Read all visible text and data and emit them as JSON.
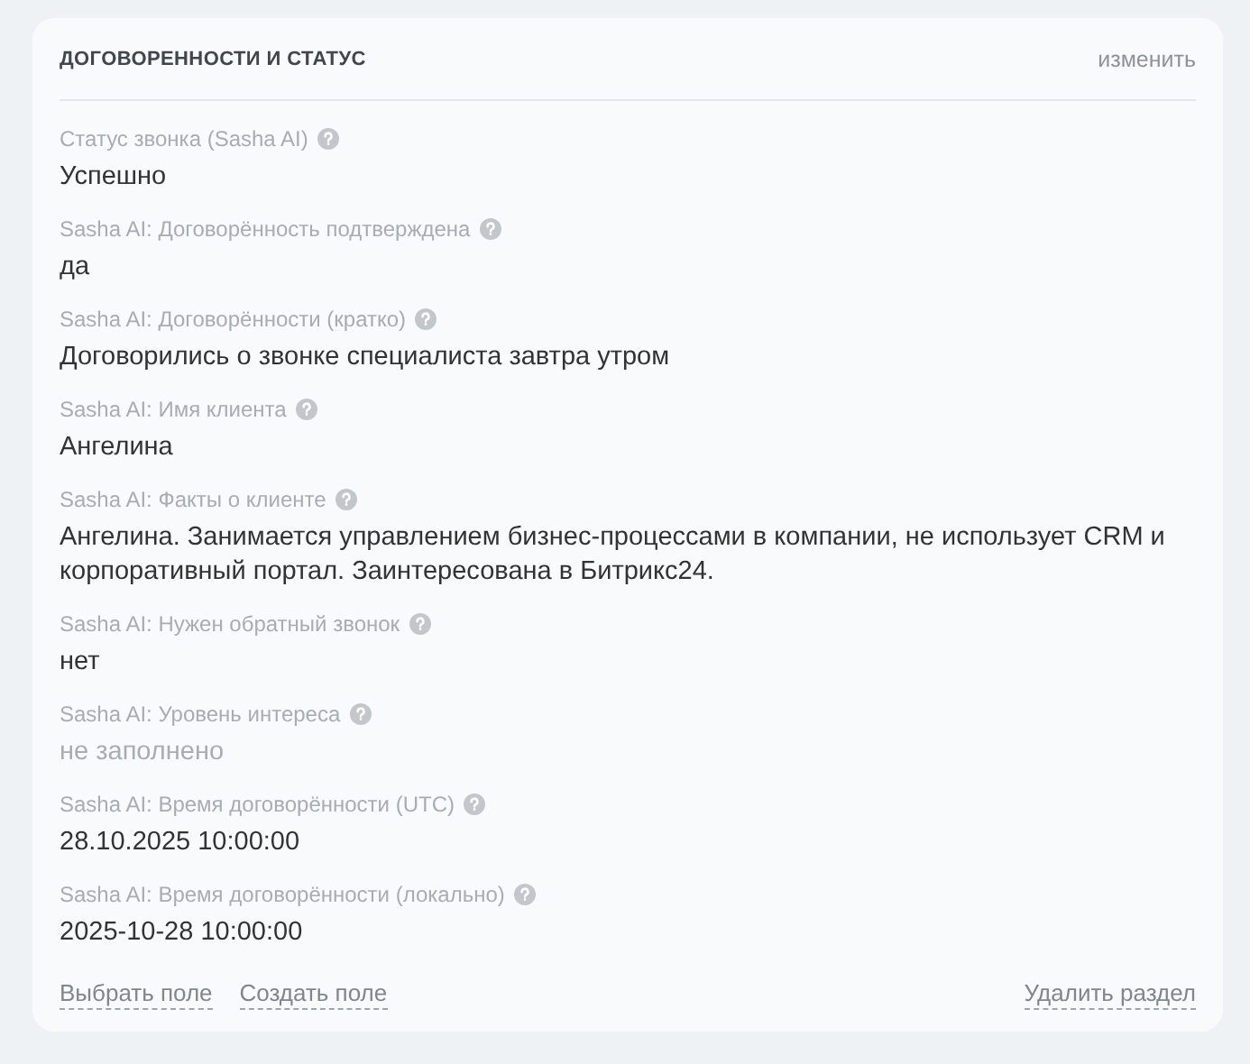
{
  "section": {
    "title": "ДОГОВОРЕННОСТИ И СТАТУС",
    "edit_link": "изменить",
    "fields": [
      {
        "label": "Статус звонка (Sasha AI)",
        "value": "Успешно",
        "empty": false
      },
      {
        "label": "Sasha AI: Договорённость подтверждена",
        "value": "да",
        "empty": false
      },
      {
        "label": "Sasha AI: Договорённости (кратко)",
        "value": "Договорились о звонке специалиста завтра утром",
        "empty": false
      },
      {
        "label": "Sasha AI: Имя клиента",
        "value": "Ангелина",
        "empty": false
      },
      {
        "label": "Sasha AI: Факты о клиенте",
        "value": "Ангелина. Занимается управлением бизнес-процессами в компании, не использует CRM и корпоративный портал. Заинтересована в Битрикс24.",
        "empty": false
      },
      {
        "label": "Sasha AI: Нужен обратный звонок",
        "value": "нет",
        "empty": false
      },
      {
        "label": "Sasha AI: Уровень интереса",
        "value": "не заполнено",
        "empty": true
      },
      {
        "label": "Sasha AI: Время договорённости (UTC)",
        "value": "28.10.2025 10:00:00",
        "empty": false
      },
      {
        "label": "Sasha AI: Время договорённости (локально)",
        "value": "2025-10-28 10:00:00",
        "empty": false
      }
    ],
    "footer_links": [
      "Выбрать поле",
      "Создать поле"
    ],
    "delete_link": "Удалить раздел"
  }
}
